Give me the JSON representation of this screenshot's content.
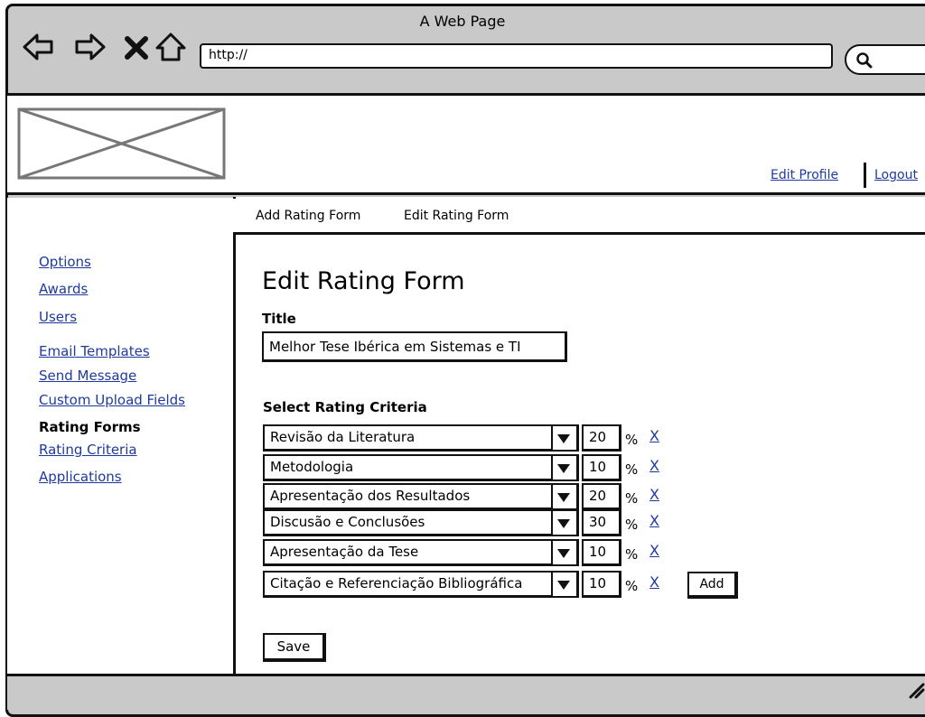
{
  "browser": {
    "title": "A Web Page",
    "url": "http://"
  },
  "header": {
    "edit_profile": "Edit Profile",
    "logout": "Logout"
  },
  "tabs": [
    "Add Rating Form",
    "Edit Rating Form"
  ],
  "sidebar": [
    {
      "label": "Options",
      "current": false
    },
    {
      "label": "Awards",
      "current": false
    },
    {
      "label": "Users",
      "current": false
    },
    {
      "label": "Email Templates",
      "current": false
    },
    {
      "label": "Send Message",
      "current": false
    },
    {
      "label": "Custom Upload Fields",
      "current": false
    },
    {
      "label": "Rating Forms",
      "current": true
    },
    {
      "label": "Rating Criteria",
      "current": false
    },
    {
      "label": "Applications",
      "current": false
    }
  ],
  "form": {
    "heading": "Edit Rating Form",
    "title_label": "Title",
    "title_value": "Melhor Tese Ibérica em Sistemas e TI",
    "criteria_label": "Select Rating Criteria",
    "percent_sign": "%",
    "remove_label": "X",
    "add_label": "Add",
    "save_label": "Save",
    "criteria": [
      {
        "name": "Revisão da Literatura",
        "weight": "20"
      },
      {
        "name": "Metodologia",
        "weight": "10"
      },
      {
        "name": "Apresentação dos Resultados",
        "weight": "20"
      },
      {
        "name": "Discusão e Conclusões",
        "weight": "30"
      },
      {
        "name": "Apresentação da Tese",
        "weight": "10"
      },
      {
        "name": "Citação e Referenciação Bibliográfica",
        "weight": "10"
      }
    ]
  }
}
